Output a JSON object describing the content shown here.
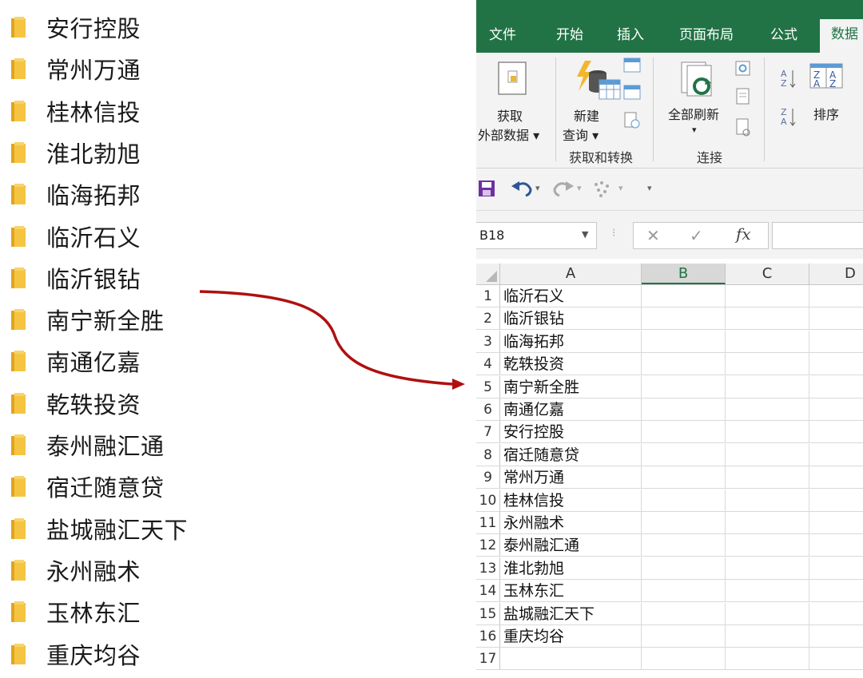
{
  "folders": [
    "安行控股",
    "常州万通",
    "桂林信投",
    "淮北勃旭",
    "临海拓邦",
    "临沂石义",
    "临沂银钻",
    "南宁新全胜",
    "南通亿嘉",
    "乾轶投资",
    "泰州融汇通",
    "宿迁随意贷",
    "盐城融汇天下",
    "永州融术",
    "玉林东汇",
    "重庆均谷"
  ],
  "excel": {
    "tabs": [
      "文件",
      "开始",
      "插入",
      "页面布局",
      "公式",
      "数据"
    ],
    "active_tab": "数据",
    "ribbon": {
      "get_external_data_line1": "获取",
      "get_external_data_line2": "外部数据 ▾",
      "new_query_line1": "新建",
      "new_query_line2": "查询 ▾",
      "group_get_transform": "获取和转换",
      "refresh_all": "全部刷新",
      "refresh_all_arrow": "▾",
      "group_connections": "连接",
      "sort": "排序",
      "sort_az_icon": "sort-az-icon",
      "sort_za_icon": "sort-za-icon"
    },
    "name_box": "B18",
    "formula_value": "",
    "fx": "fx",
    "columns": [
      "A",
      "B",
      "C",
      "D"
    ],
    "selected_column": "B",
    "rows": [
      {
        "n": "1",
        "a": "临沂石义"
      },
      {
        "n": "2",
        "a": "临沂银钻"
      },
      {
        "n": "3",
        "a": "临海拓邦"
      },
      {
        "n": "4",
        "a": "乾轶投资"
      },
      {
        "n": "5",
        "a": "南宁新全胜"
      },
      {
        "n": "6",
        "a": "南通亿嘉"
      },
      {
        "n": "7",
        "a": "安行控股"
      },
      {
        "n": "8",
        "a": "宿迁随意贷"
      },
      {
        "n": "9",
        "a": "常州万通"
      },
      {
        "n": "10",
        "a": "桂林信投"
      },
      {
        "n": "11",
        "a": "永州融术"
      },
      {
        "n": "12",
        "a": "泰州融汇通"
      },
      {
        "n": "13",
        "a": "淮北勃旭"
      },
      {
        "n": "14",
        "a": "玉林东汇"
      },
      {
        "n": "15",
        "a": "盐城融汇天下"
      },
      {
        "n": "16",
        "a": "重庆均谷"
      },
      {
        "n": "17",
        "a": ""
      }
    ]
  },
  "colors": {
    "excel_green": "#217346",
    "folder_yellow": "#f5c542",
    "arrow_red": "#b01010"
  }
}
